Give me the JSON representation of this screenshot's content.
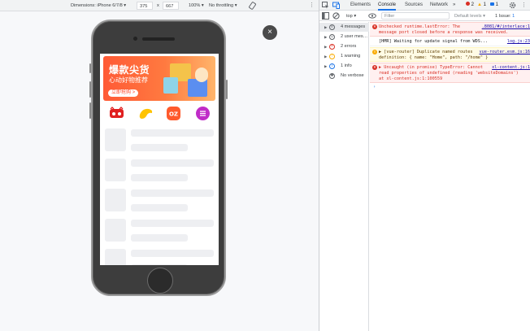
{
  "emulation": {
    "dimensions_label": "Dimensions: iPhone 6/7/8 ▾",
    "width": "375",
    "separator": "x",
    "height": "667",
    "zoom": "100% ▾",
    "throttling": "No throttling ▾",
    "close_label": "×"
  },
  "phone_page": {
    "banner": {
      "title": "爆款尖货",
      "subtitle": "心动好物推荐",
      "cta": "立即抢购 >"
    },
    "category_icons": [
      "tmall-icon",
      "fliggy-icon",
      "taobao-oz-icon",
      "menu-list-icon"
    ],
    "skeleton_rows": 5
  },
  "devtools": {
    "tabs": [
      "Elements",
      "Console",
      "Sources",
      "Network",
      "»"
    ],
    "active_tab": "Console",
    "error_count": "2",
    "warning_count": "1",
    "info_count": "1",
    "context": "top ▾",
    "filter_placeholder": "Filter",
    "levels": "Default levels ▾",
    "issues": "1 Issue: ",
    "issues_count": "1",
    "sidebar": [
      {
        "label": "4 messages",
        "icon": "list-icon",
        "color": "#5f6368"
      },
      {
        "label": "2 user mes…",
        "icon": "user-icon",
        "color": "#5f6368"
      },
      {
        "label": "2 errors",
        "icon": "error-icon",
        "color": "#d93025"
      },
      {
        "label": "1 warning",
        "icon": "warning-icon",
        "color": "#f9ab00"
      },
      {
        "label": "1 info",
        "icon": "info-icon",
        "color": "#1a73e8"
      },
      {
        "label": "No verbose",
        "icon": "bug-icon",
        "color": "#5f6368"
      }
    ],
    "messages": [
      {
        "level": "error",
        "lines": [
          "Unchecked runtime.lastError: The",
          "message port closed before a response was received."
        ],
        "source": ".8081/#/interlace:1"
      },
      {
        "level": "info",
        "lines": [
          "[HMR] Waiting for update signal from WDS..."
        ],
        "source": "log.js:23"
      },
      {
        "level": "warning",
        "lines": [
          "▶ [vue-router] Duplicate named routes",
          "definition: { name: \"Home\", path: \"/home\" }"
        ],
        "source": "vue-router.esm.js:16"
      },
      {
        "level": "error",
        "lines": [
          "▶ Uncaught (in promise) TypeError: Cannot",
          "read properties of undefined (reading 'websiteDomains')",
          "at xl-content.js:1:100559"
        ],
        "source": "xl-content.js:1"
      }
    ],
    "prompt": "›"
  },
  "colors": {
    "accent": "#1a73e8",
    "error": "#d93025",
    "warning": "#f9ab00",
    "banner": "#ff5a36"
  }
}
